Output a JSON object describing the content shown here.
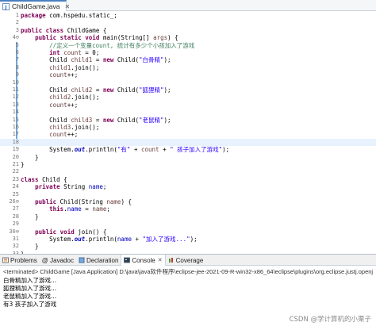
{
  "editor_tab": {
    "title": "ChildGame.java"
  },
  "code_lines": [
    {
      "n": "1",
      "tokens": [
        [
          "kw",
          "package"
        ],
        [
          "p",
          " com.hspedu.static_;"
        ]
      ]
    },
    {
      "n": "2",
      "tokens": []
    },
    {
      "n": "3",
      "tokens": [
        [
          "kw",
          "public"
        ],
        [
          "p",
          " "
        ],
        [
          "kw",
          "class"
        ],
        [
          "p",
          " ChildGame {"
        ]
      ]
    },
    {
      "n": "4⊖",
      "tokens": [
        [
          "p",
          "    "
        ],
        [
          "kw",
          "public"
        ],
        [
          "p",
          " "
        ],
        [
          "kw",
          "static"
        ],
        [
          "p",
          " "
        ],
        [
          "kw",
          "void"
        ],
        [
          "p",
          " main(String[] "
        ],
        [
          "var",
          "args"
        ],
        [
          "p",
          ") {"
        ]
      ]
    },
    {
      "n": "5",
      "tokens": [
        [
          "p",
          "        "
        ],
        [
          "cmt",
          "//定义一个变量count, 统计有多少个小孩加入了游戏"
        ]
      ]
    },
    {
      "n": "6",
      "tokens": [
        [
          "p",
          "        "
        ],
        [
          "kw",
          "int"
        ],
        [
          "p",
          " "
        ],
        [
          "var",
          "count"
        ],
        [
          "p",
          " = 0;"
        ]
      ]
    },
    {
      "n": "7",
      "tokens": [
        [
          "p",
          "        Child "
        ],
        [
          "var",
          "child1"
        ],
        [
          "p",
          " = "
        ],
        [
          "kw",
          "new"
        ],
        [
          "p",
          " Child("
        ],
        [
          "str",
          "\"白骨精\""
        ],
        [
          "p",
          ");"
        ]
      ]
    },
    {
      "n": "8",
      "tokens": [
        [
          "p",
          "        "
        ],
        [
          "var",
          "child1"
        ],
        [
          "p",
          ".join();"
        ]
      ]
    },
    {
      "n": "9",
      "tokens": [
        [
          "p",
          "        "
        ],
        [
          "var",
          "count"
        ],
        [
          "p",
          "++;"
        ]
      ]
    },
    {
      "n": "10",
      "tokens": []
    },
    {
      "n": "11",
      "tokens": [
        [
          "p",
          "        Child "
        ],
        [
          "var",
          "child2"
        ],
        [
          "p",
          " = "
        ],
        [
          "kw",
          "new"
        ],
        [
          "p",
          " Child("
        ],
        [
          "str",
          "\"狐狸精\""
        ],
        [
          "p",
          ");"
        ]
      ]
    },
    {
      "n": "12",
      "tokens": [
        [
          "p",
          "        "
        ],
        [
          "var",
          "child2"
        ],
        [
          "p",
          ".join();"
        ]
      ]
    },
    {
      "n": "13",
      "tokens": [
        [
          "p",
          "        "
        ],
        [
          "var",
          "count"
        ],
        [
          "p",
          "++;"
        ]
      ]
    },
    {
      "n": "14",
      "tokens": []
    },
    {
      "n": "15",
      "tokens": [
        [
          "p",
          "        Child "
        ],
        [
          "var",
          "child3"
        ],
        [
          "p",
          " = "
        ],
        [
          "kw",
          "new"
        ],
        [
          "p",
          " Child("
        ],
        [
          "str",
          "\"老鼠精\""
        ],
        [
          "p",
          ");"
        ]
      ]
    },
    {
      "n": "16",
      "tokens": [
        [
          "p",
          "        "
        ],
        [
          "var",
          "child3"
        ],
        [
          "p",
          ".join();"
        ]
      ]
    },
    {
      "n": "17",
      "tokens": [
        [
          "p",
          "        "
        ],
        [
          "var",
          "count"
        ],
        [
          "p",
          "++;"
        ]
      ]
    },
    {
      "n": "18",
      "tokens": [],
      "current": true
    },
    {
      "n": "19",
      "tokens": [
        [
          "p",
          "        System."
        ],
        [
          "static-fld",
          "out"
        ],
        [
          "p",
          ".println("
        ],
        [
          "str",
          "\"有\""
        ],
        [
          "p",
          " + "
        ],
        [
          "var",
          "count"
        ],
        [
          "p",
          " + "
        ],
        [
          "str",
          "\" 孩子加入了游戏\""
        ],
        [
          "p",
          ");"
        ]
      ]
    },
    {
      "n": "20",
      "tokens": [
        [
          "p",
          "    }"
        ]
      ]
    },
    {
      "n": "21",
      "tokens": [
        [
          "p",
          "}"
        ]
      ]
    },
    {
      "n": "22",
      "tokens": []
    },
    {
      "n": "23",
      "tokens": [
        [
          "kw",
          "class"
        ],
        [
          "p",
          " Child {"
        ]
      ]
    },
    {
      "n": "24",
      "tokens": [
        [
          "p",
          "    "
        ],
        [
          "kw",
          "private"
        ],
        [
          "p",
          " String "
        ],
        [
          "fld",
          "name"
        ],
        [
          "p",
          ";"
        ]
      ]
    },
    {
      "n": "25",
      "tokens": []
    },
    {
      "n": "26⊖",
      "tokens": [
        [
          "p",
          "    "
        ],
        [
          "kw",
          "public"
        ],
        [
          "p",
          " Child(String "
        ],
        [
          "var",
          "name"
        ],
        [
          "p",
          ") {"
        ]
      ]
    },
    {
      "n": "27",
      "tokens": [
        [
          "p",
          "        "
        ],
        [
          "kw",
          "this"
        ],
        [
          "p",
          "."
        ],
        [
          "fld",
          "name"
        ],
        [
          "p",
          " = "
        ],
        [
          "var",
          "name"
        ],
        [
          "p",
          ";"
        ]
      ]
    },
    {
      "n": "28",
      "tokens": [
        [
          "p",
          "    }"
        ]
      ]
    },
    {
      "n": "29",
      "tokens": []
    },
    {
      "n": "30⊖",
      "tokens": [
        [
          "p",
          "    "
        ],
        [
          "kw",
          "public"
        ],
        [
          "p",
          " "
        ],
        [
          "kw",
          "void"
        ],
        [
          "p",
          " join() {"
        ]
      ]
    },
    {
      "n": "31",
      "tokens": [
        [
          "p",
          "        System."
        ],
        [
          "static-fld",
          "out"
        ],
        [
          "p",
          ".println("
        ],
        [
          "fld",
          "name"
        ],
        [
          "p",
          " + "
        ],
        [
          "str",
          "\"加入了游戏...\""
        ],
        [
          "p",
          ");"
        ]
      ]
    },
    {
      "n": "32",
      "tokens": [
        [
          "p",
          "    }"
        ]
      ]
    },
    {
      "n": "33",
      "tokens": [
        [
          "p",
          "}"
        ]
      ]
    }
  ],
  "panel_tabs": [
    {
      "label": "Problems",
      "icon": "problems-icon"
    },
    {
      "label": "@ Javadoc",
      "icon": ""
    },
    {
      "label": "Declaration",
      "icon": "declaration-icon"
    },
    {
      "label": "Console",
      "icon": "console-icon",
      "active": true
    },
    {
      "label": "Coverage",
      "icon": "coverage-icon"
    }
  ],
  "console": {
    "header": "<terminated> ChildGame [Java Application] D:\\java\\java软件程序\\eclipse-jee-2021-09-R-win32-x86_64\\eclipse\\plugins\\org.eclipse.justj.openj",
    "lines": [
      "白骨精加入了游戏...",
      "狐狸精加入了游戏...",
      "老鼠精加入了游戏...",
      "有3 孩子加入了游戏"
    ]
  },
  "watermark": "CSDN @学计算机的小栗子",
  "colors": {
    "keyword": "#7f0055",
    "string": "#2a00ff",
    "comment": "#3f7f5f",
    "field": "#0000c0",
    "current_line": "#e8f2fe"
  }
}
